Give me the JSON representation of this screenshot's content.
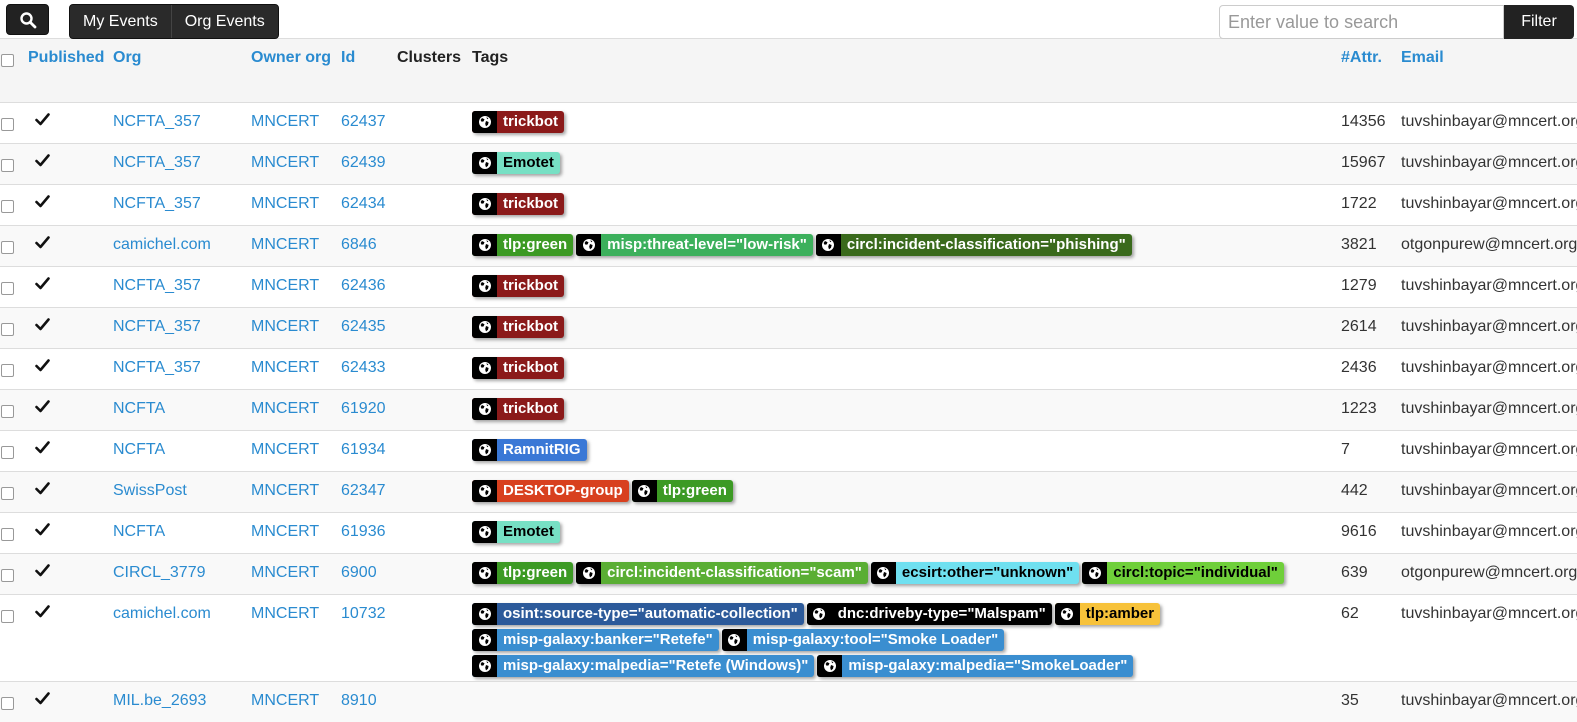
{
  "toolbar": {
    "view_buttons": [
      "My Events",
      "Org Events"
    ],
    "search_placeholder": "Enter value to search",
    "filter_label": "Filter"
  },
  "columns": {
    "published": "Published",
    "org": "Org",
    "owner_org": "Owner org",
    "id": "Id",
    "clusters": "Clusters",
    "tags": "Tags",
    "attr": "#Attr.",
    "email": "Email"
  },
  "rows": [
    {
      "org": "NCFTA_357",
      "owner": "MNCERT",
      "id": "62437",
      "attr": "14356",
      "email": "tuvshinbayar@mncert.org",
      "tags": [
        [
          "trickbot"
        ]
      ]
    },
    {
      "org": "NCFTA_357",
      "owner": "MNCERT",
      "id": "62439",
      "attr": "15967",
      "email": "tuvshinbayar@mncert.org",
      "tags": [
        [
          "Emotet"
        ]
      ]
    },
    {
      "org": "NCFTA_357",
      "owner": "MNCERT",
      "id": "62434",
      "attr": "1722",
      "email": "tuvshinbayar@mncert.org",
      "tags": [
        [
          "trickbot"
        ]
      ]
    },
    {
      "org": "camichel.com",
      "owner": "MNCERT",
      "id": "6846",
      "attr": "3821",
      "email": "otgonpurew@mncert.org",
      "tags": [
        [
          "tlp:green",
          "misp:threat-level=\"low-risk\"",
          "circl:incident-classification=\"phishing\""
        ]
      ]
    },
    {
      "org": "NCFTA_357",
      "owner": "MNCERT",
      "id": "62436",
      "attr": "1279",
      "email": "tuvshinbayar@mncert.org",
      "tags": [
        [
          "trickbot"
        ]
      ]
    },
    {
      "org": "NCFTA_357",
      "owner": "MNCERT",
      "id": "62435",
      "attr": "2614",
      "email": "tuvshinbayar@mncert.org",
      "tags": [
        [
          "trickbot"
        ]
      ]
    },
    {
      "org": "NCFTA_357",
      "owner": "MNCERT",
      "id": "62433",
      "attr": "2436",
      "email": "tuvshinbayar@mncert.org",
      "tags": [
        [
          "trickbot"
        ]
      ]
    },
    {
      "org": "NCFTA",
      "owner": "MNCERT",
      "id": "61920",
      "attr": "1223",
      "email": "tuvshinbayar@mncert.org",
      "tags": [
        [
          "trickbot"
        ]
      ]
    },
    {
      "org": "NCFTA",
      "owner": "MNCERT",
      "id": "61934",
      "attr": "7",
      "email": "tuvshinbayar@mncert.org",
      "tags": [
        [
          "RamnitRIG"
        ]
      ]
    },
    {
      "org": "SwissPost",
      "owner": "MNCERT",
      "id": "62347",
      "attr": "442",
      "email": "tuvshinbayar@mncert.org",
      "tags": [
        [
          "DESKTOP-group",
          "tlp:green"
        ]
      ]
    },
    {
      "org": "NCFTA",
      "owner": "MNCERT",
      "id": "61936",
      "attr": "9616",
      "email": "tuvshinbayar@mncert.org",
      "tags": [
        [
          "Emotet"
        ]
      ]
    },
    {
      "org": "CIRCL_3779",
      "owner": "MNCERT",
      "id": "6900",
      "attr": "639",
      "email": "otgonpurew@mncert.org",
      "tags": [
        [
          "tlp:green",
          "circl:incident-classification=\"scam\"",
          "ecsirt:other=\"unknown\"",
          "circl:topic=\"individual\""
        ]
      ]
    },
    {
      "org": "camichel.com",
      "owner": "MNCERT",
      "id": "10732",
      "attr": "62",
      "email": "tuvshinbayar@mncert.org",
      "tags": [
        [
          "osint:source-type=\"automatic-collection\"",
          "dnc:driveby-type=\"Malspam\"",
          "tlp:amber"
        ],
        [
          "misp-galaxy:banker=\"Retefe\"",
          "misp-galaxy:tool=\"Smoke Loader\""
        ],
        [
          "misp-galaxy:malpedia=\"Retefe (Windows)\"",
          "misp-galaxy:malpedia=\"SmokeLoader\""
        ]
      ]
    },
    {
      "org": "MIL.be_2693",
      "owner": "MNCERT",
      "id": "8910",
      "attr": "35",
      "email": "tuvshinbayar@mncert.org",
      "tags": []
    }
  ],
  "tag_colors": {
    "trickbot": {
      "bg": "#8b1a1a",
      "fg": "#ffffff"
    },
    "Emotet": {
      "bg": "#77e0c4",
      "fg": "#000000"
    },
    "tlp:green": {
      "bg": "#3c9a24",
      "fg": "#ffffff"
    },
    "misp:threat-level=\"low-risk\"": {
      "bg": "#3cb05c",
      "fg": "#ffffff"
    },
    "circl:incident-classification=\"phishing\"": {
      "bg": "#3a6a1c",
      "fg": "#ffffff"
    },
    "RamnitRIG": {
      "bg": "#3a78d6",
      "fg": "#ffffff"
    },
    "DESKTOP-group": {
      "bg": "#d8401e",
      "fg": "#ffffff"
    },
    "circl:incident-classification=\"scam\"": {
      "bg": "#5aae34",
      "fg": "#ffffff"
    },
    "ecsirt:other=\"unknown\"": {
      "bg": "#6fe0f0",
      "fg": "#000000"
    },
    "circl:topic=\"individual\"": {
      "bg": "#6fcf3a",
      "fg": "#000000"
    },
    "osint:source-type=\"automatic-collection\"": {
      "bg": "#2c5a9a",
      "fg": "#ffffff"
    },
    "dnc:driveby-type=\"Malspam\"": {
      "bg": "#000000",
      "fg": "#ffffff"
    },
    "tlp:amber": {
      "bg": "#f7c23a",
      "fg": "#000000"
    },
    "misp-galaxy:banker=\"Retefe\"": {
      "bg": "#3a8ed0",
      "fg": "#ffffff"
    },
    "misp-galaxy:tool=\"Smoke Loader\"": {
      "bg": "#3a8ed0",
      "fg": "#ffffff"
    },
    "misp-galaxy:malpedia=\"Retefe (Windows)\"": {
      "bg": "#3a8ed0",
      "fg": "#ffffff"
    },
    "misp-galaxy:malpedia=\"SmokeLoader\"": {
      "bg": "#3a8ed0",
      "fg": "#ffffff"
    }
  },
  "icons": {
    "search": "search-icon",
    "check": "checkmark-icon",
    "tag": "globe-icon"
  }
}
